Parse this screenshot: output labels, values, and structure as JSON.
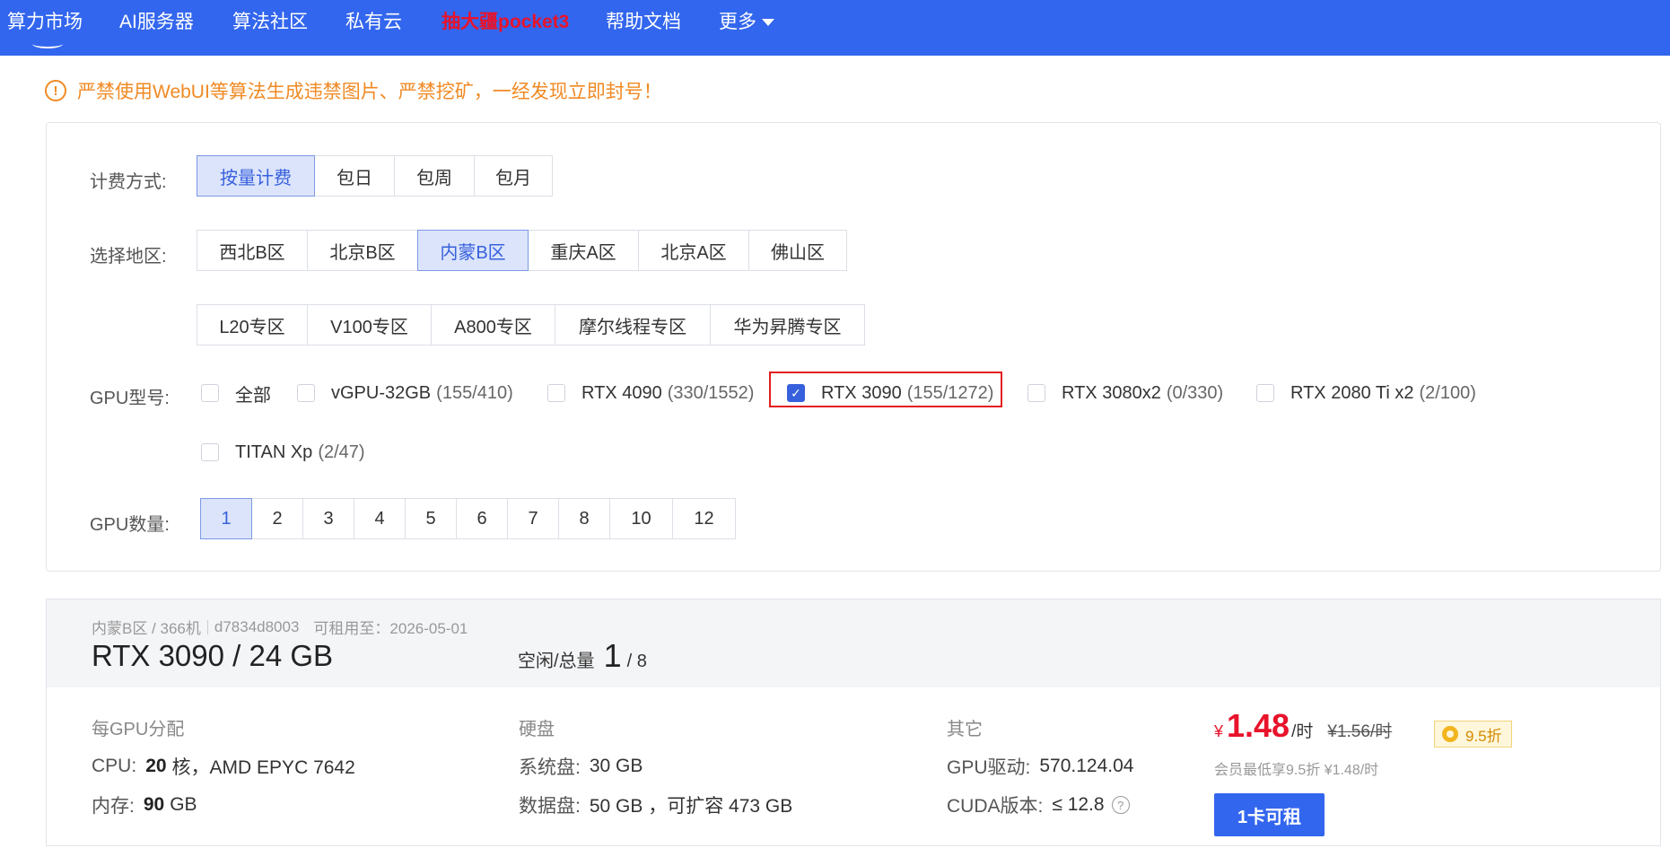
{
  "nav": {
    "items": [
      {
        "label": "算力市场"
      },
      {
        "label": "AI服务器"
      },
      {
        "label": "算法社区"
      },
      {
        "label": "私有云"
      },
      {
        "label": "抽大疆pocket3"
      },
      {
        "label": "帮助文档"
      },
      {
        "label": "更多"
      }
    ],
    "active_index": 0,
    "highlight_color": "#e8132b",
    "bar_color": "#3366ee"
  },
  "warning": {
    "icon": "exclamation-circle-icon",
    "text": "严禁使用WebUI等算法生成违禁图片、严禁挖矿，一经发现立即封号！"
  },
  "filters": {
    "billing": {
      "label": "计费方式:",
      "options": [
        "按量计费",
        "包日",
        "包周",
        "包月"
      ],
      "selected": "按量计费"
    },
    "region": {
      "label": "选择地区:",
      "row1": [
        "西北B区",
        "北京B区",
        "内蒙B区",
        "重庆A区",
        "北京A区",
        "佛山区"
      ],
      "row2": [
        "L20专区",
        "V100专区",
        "A800专区",
        "摩尔线程专区",
        "华为昇腾专区"
      ],
      "selected": "内蒙B区"
    },
    "gpu_model": {
      "label": "GPU型号:",
      "options": [
        {
          "name": "全部",
          "count": "",
          "checked": false
        },
        {
          "name": "vGPU-32GB",
          "count": "(155/410)",
          "checked": false
        },
        {
          "name": "RTX 4090",
          "count": "(330/1552)",
          "checked": false
        },
        {
          "name": "RTX 3090",
          "count": "(155/1272)",
          "checked": true
        },
        {
          "name": "RTX 3080x2",
          "count": "(0/330)",
          "checked": false
        },
        {
          "name": "RTX 2080 Ti x2",
          "count": "(2/100)",
          "checked": false
        },
        {
          "name": "TITAN Xp",
          "count": "(2/47)",
          "checked": false
        }
      ],
      "check_mark": "✓"
    },
    "gpu_count": {
      "label": "GPU数量:",
      "options": [
        "1",
        "2",
        "3",
        "4",
        "5",
        "6",
        "7",
        "8",
        "10",
        "12"
      ],
      "selected": "1"
    }
  },
  "machine": {
    "region": "内蒙B区 / 366机",
    "id": "d7834d8003",
    "available_until": "可租用至：2026-05-01",
    "title": "RTX 3090 / 24 GB",
    "idle_label": "空闲/总量",
    "idle_free": "1",
    "idle_total": "/ 8",
    "per_gpu": {
      "title": "每GPU分配",
      "cpu_key": "CPU:",
      "cpu_cores": "20",
      "cpu_rest": "核，AMD EPYC 7642",
      "mem_key": "内存:",
      "mem_value": "90",
      "mem_unit": "GB"
    },
    "disk": {
      "title": "硬盘",
      "sys_key": "系统盘:",
      "sys_value": "30 GB",
      "data_key": "数据盘:",
      "data_value": "50 GB ，可扩容 473 GB"
    },
    "other": {
      "title": "其它",
      "driver_key": "GPU驱动:",
      "driver_value": "570.124.04",
      "cuda_key": "CUDA版本:",
      "cuda_value": "≤ 12.8",
      "help_icon": "question-circle-icon"
    },
    "price": {
      "currency": "¥",
      "amount": "1.48",
      "unit": "/时",
      "original": "¥1.56/时",
      "discount": "9.5折",
      "member_note": "会员最低享9.5折 ¥1.48/时"
    },
    "rent_button": "1卡可租"
  }
}
